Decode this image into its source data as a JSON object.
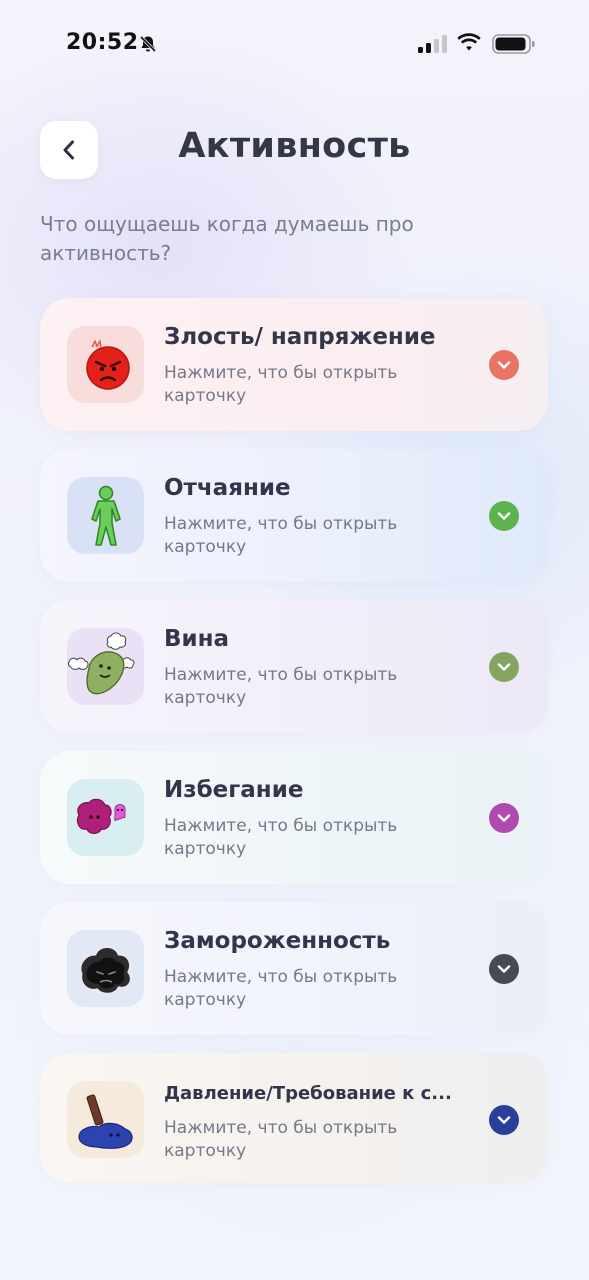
{
  "status_bar": {
    "time": "20:52",
    "icons": [
      "bell-slash-icon",
      "cellular-signal-icon",
      "wifi-icon",
      "battery-icon"
    ]
  },
  "header": {
    "back_icon": "chevron-left-icon",
    "title": "Активность"
  },
  "question": "Что ощущаешь когда думаешь про активность?",
  "cards": [
    {
      "title": "Злость/ напряжение",
      "description": "Нажмите, что бы открыть карточку",
      "icon": "angry-red-face-icon",
      "accent": "#ea7462",
      "background": "#fbeef1",
      "icon_bg": "#f9dede"
    },
    {
      "title": "Отчаяние",
      "description": "Нажмите, что бы открыть карточку",
      "icon": "green-figure-icon",
      "accent": "#5db34f",
      "background": "#edf1fc",
      "icon_bg": "#dce3f8"
    },
    {
      "title": "Вина",
      "description": "Нажмите, что бы открыть карточку",
      "icon": "green-blob-with-clouds-icon",
      "accent": "#86a461",
      "background": "#f1eff9",
      "icon_bg": "#ebe2f6"
    },
    {
      "title": "Избегание",
      "description": "Нажмите, что бы открыть карточку",
      "icon": "magenta-blobs-icon",
      "accent": "#b04ab0",
      "background": "#eff5f8",
      "icon_bg": "#dbeef0"
    },
    {
      "title": "Замороженность",
      "description": "Нажмите, что бы открыть карточку",
      "icon": "dark-cloud-face-icon",
      "accent": "#474a55",
      "background": "#f1f3fb",
      "icon_bg": "#e2e8f5"
    },
    {
      "title": "Давление/Требование к с...",
      "description": "Нажмите, что бы открыть карточку",
      "icon": "hammer-on-blue-blob-icon",
      "accent": "#283f9c",
      "background": "#f4f2ef",
      "icon_bg": "#f6ecdf"
    }
  ]
}
